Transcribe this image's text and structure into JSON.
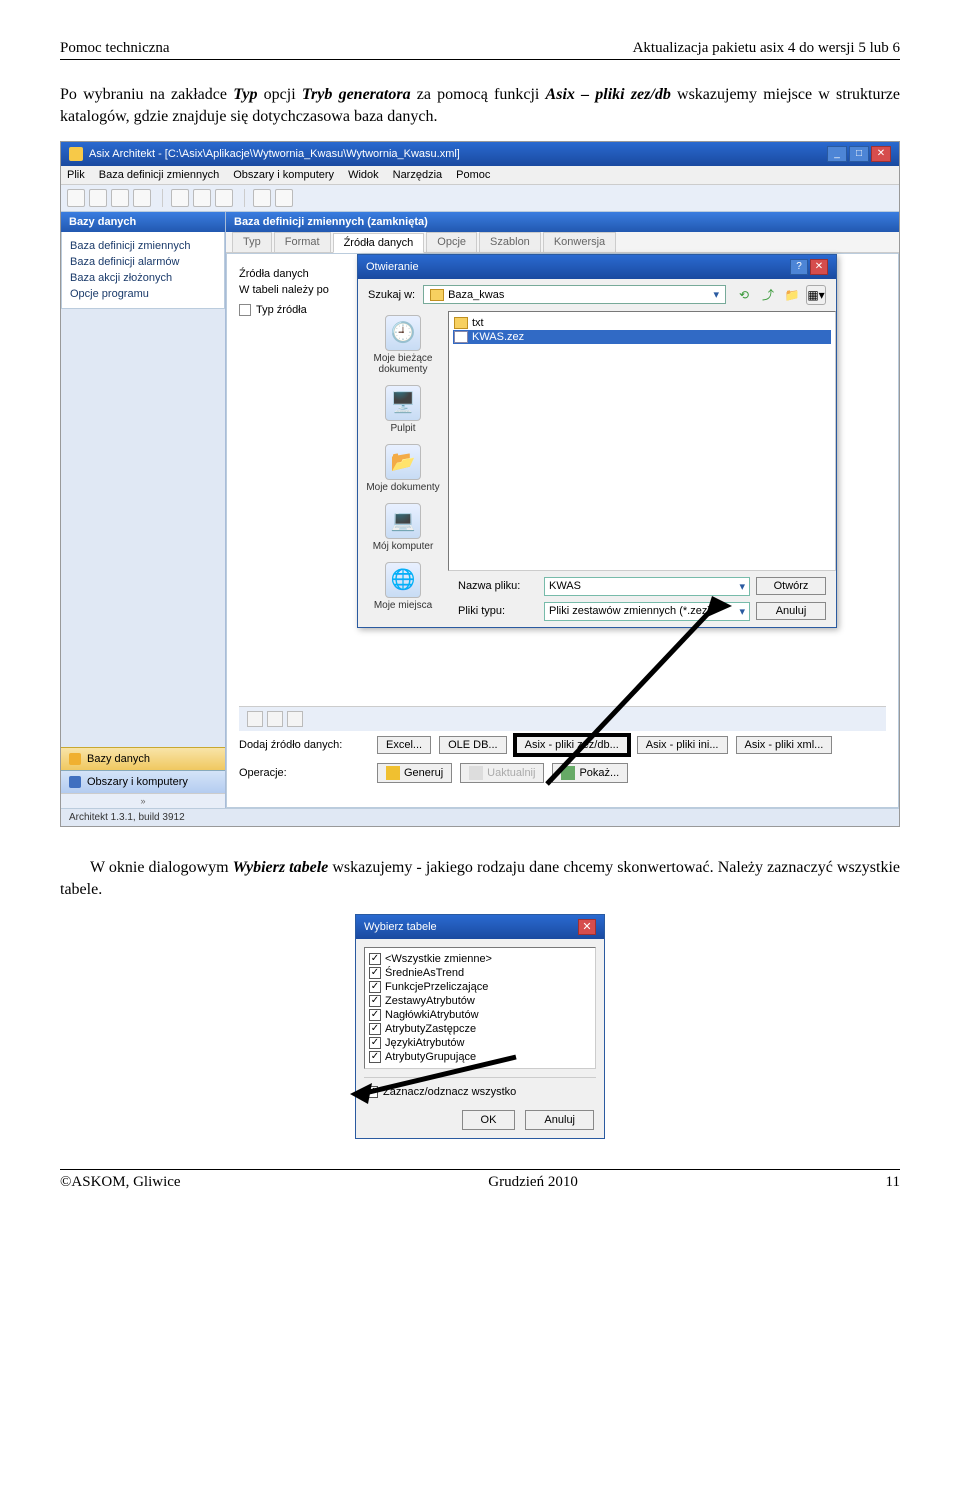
{
  "header": {
    "left": "Pomoc techniczna",
    "right": "Aktualizacja pakietu asix 4 do wersji 5 lub 6"
  },
  "para1_a": "Po wybraniu na zakładce ",
  "para1_b": "Typ",
  "para1_c": " opcji ",
  "para1_d": "Tryb generatora",
  "para1_e": " za pomocą funkcji ",
  "para1_f": "Asix – pliki zez/db",
  "para1_g": " wskazujemy miejsce w strukturze katalogów, gdzie znajduje się dotychczasowa baza danych.",
  "app": {
    "title": "Asix Architekt - [C:\\Asix\\Aplikacje\\Wytwornia_Kwasu\\Wytwornia_Kwasu.xml]",
    "menu": [
      "Plik",
      "Baza definicji zmiennych",
      "Obszary i komputery",
      "Widok",
      "Narzędzia",
      "Pomoc"
    ],
    "sidebar": {
      "title": "Bazy danych",
      "items": [
        "Baza definicji zmiennych",
        "Baza definicji alarmów",
        "Baza akcji złożonych",
        "Opcje programu"
      ],
      "tab1": "Bazy danych",
      "tab2": "Obszary i komputery"
    },
    "panel": {
      "title": "Baza definicji zmiennych (zamknięta)",
      "tabs": [
        "Typ",
        "Format",
        "Źródła danych",
        "Opcje",
        "Szablon",
        "Konwersja"
      ],
      "sub1": "Źródła danych",
      "sub2": "W tabeli należy po",
      "col": "Typ źródła"
    },
    "filedlg": {
      "title": "Otwieranie",
      "lookin": "Szukaj w:",
      "folder": "Baza_kwas",
      "files": [
        "txt",
        "KWAS.zez"
      ],
      "places": [
        "Moje bieżące dokumenty",
        "Pulpit",
        "Moje dokumenty",
        "Mój komputer",
        "Moje miejsca"
      ],
      "fname_l": "Nazwa pliku:",
      "fname_v": "KWAS",
      "ftype_l": "Pliki typu:",
      "ftype_v": "Pliki zestawów zmiennych (*.zez)",
      "open": "Otwórz",
      "cancel": "Anuluj"
    },
    "bottom": {
      "add": "Dodaj źródło danych:",
      "btns": [
        "Excel...",
        "OLE DB...",
        "Asix - pliki zez/db...",
        "Asix - pliki ini...",
        "Asix - pliki xml..."
      ],
      "ops": "Operacje:",
      "gen": "Generuj",
      "upd": "Uaktualnij",
      "show": "Pokaż..."
    },
    "status": "Architekt 1.3.1, build 3912"
  },
  "para2_a": "W oknie dialogowym ",
  "para2_b": "Wybierz tabele",
  "para2_c": " wskazujemy - jakiego rodzaju dane chcemy skonwertować. Należy zaznaczyć wszystkie tabele.",
  "dialog2": {
    "title": "Wybierz tabele",
    "items": [
      "<Wszystkie zmienne>",
      "ŚrednieAsTrend",
      "FunkcjePrzeliczające",
      "ZestawyAtrybutów",
      "NagłówkiAtrybutów",
      "AtrybutyZastępcze",
      "JęzykiAtrybutów",
      "AtrybutyGrupujące"
    ],
    "checkall": "Zaznacz/odznacz wszystko",
    "ok": "OK",
    "cancel": "Anuluj"
  },
  "footer": {
    "left": "©ASKOM, Gliwice",
    "mid": "Grudzień 2010",
    "right": "11"
  }
}
